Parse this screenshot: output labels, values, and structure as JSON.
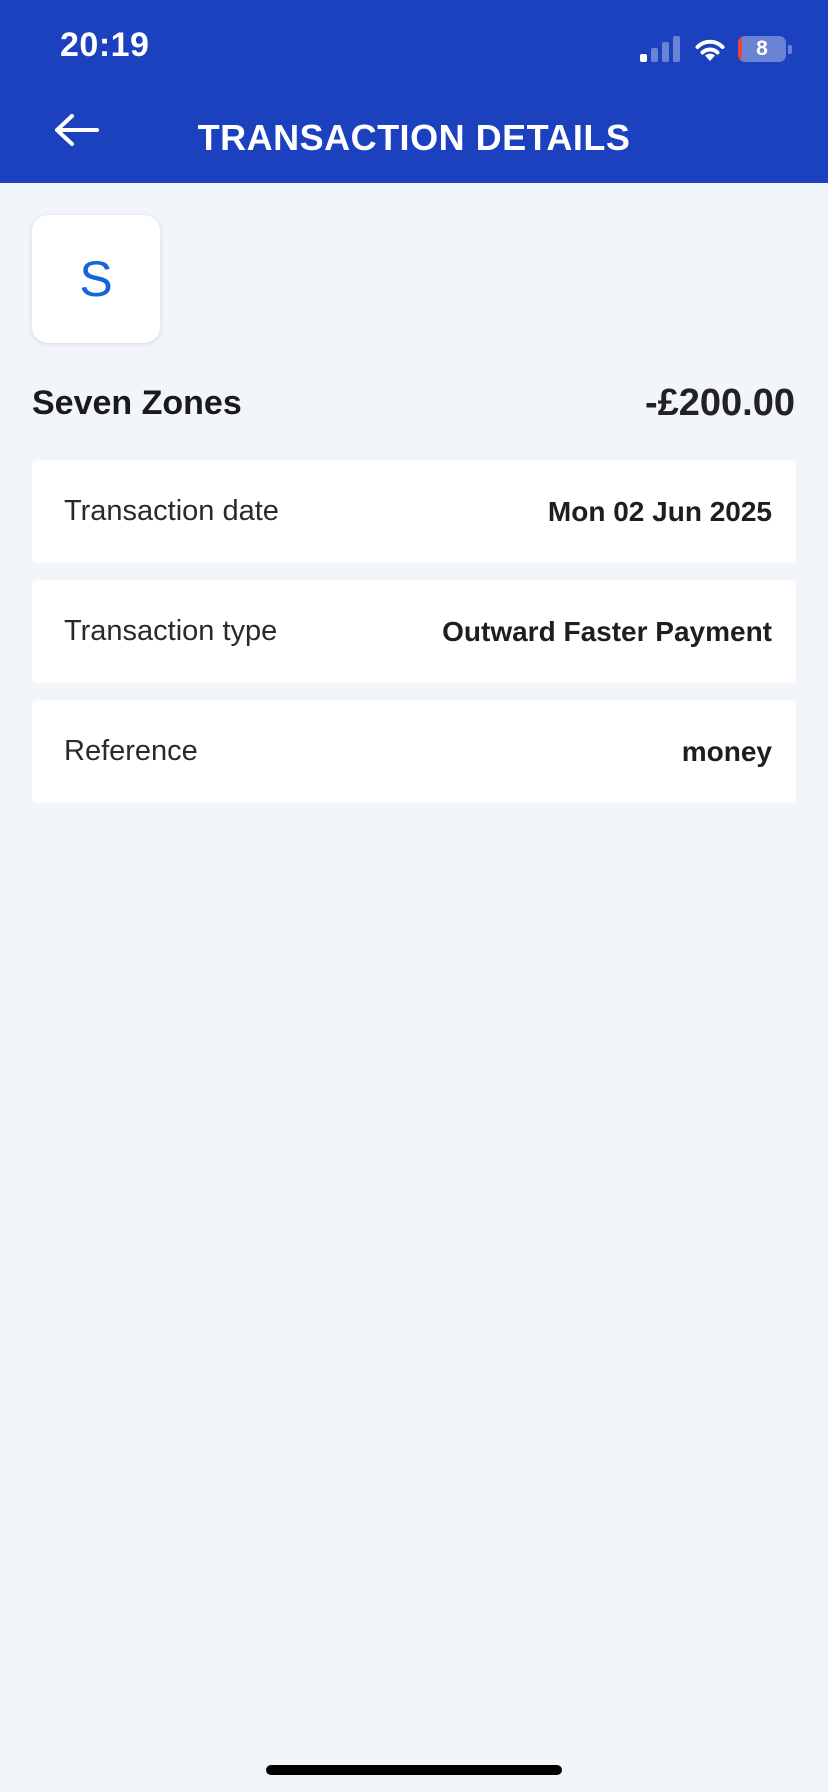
{
  "status_bar": {
    "time": "20:19",
    "battery": "8",
    "battery_level_percent": 8,
    "icons": [
      "signal-icon",
      "wifi-icon",
      "battery-icon"
    ]
  },
  "header": {
    "title": "TRANSACTION DETAILS",
    "back_icon": "arrow-left-icon",
    "background_color": "#1b41bf"
  },
  "merchant": {
    "initial": "S",
    "name": "Seven Zones",
    "amount": "-£200.00"
  },
  "details": [
    {
      "label": "Transaction date",
      "value": "Mon 02 Jun 2025"
    },
    {
      "label": "Transaction type",
      "value": "Outward Faster Payment"
    },
    {
      "label": "Reference",
      "value": "money"
    }
  ],
  "colors": {
    "accent": "#1565d8",
    "page_background": "#f2f6fa"
  }
}
